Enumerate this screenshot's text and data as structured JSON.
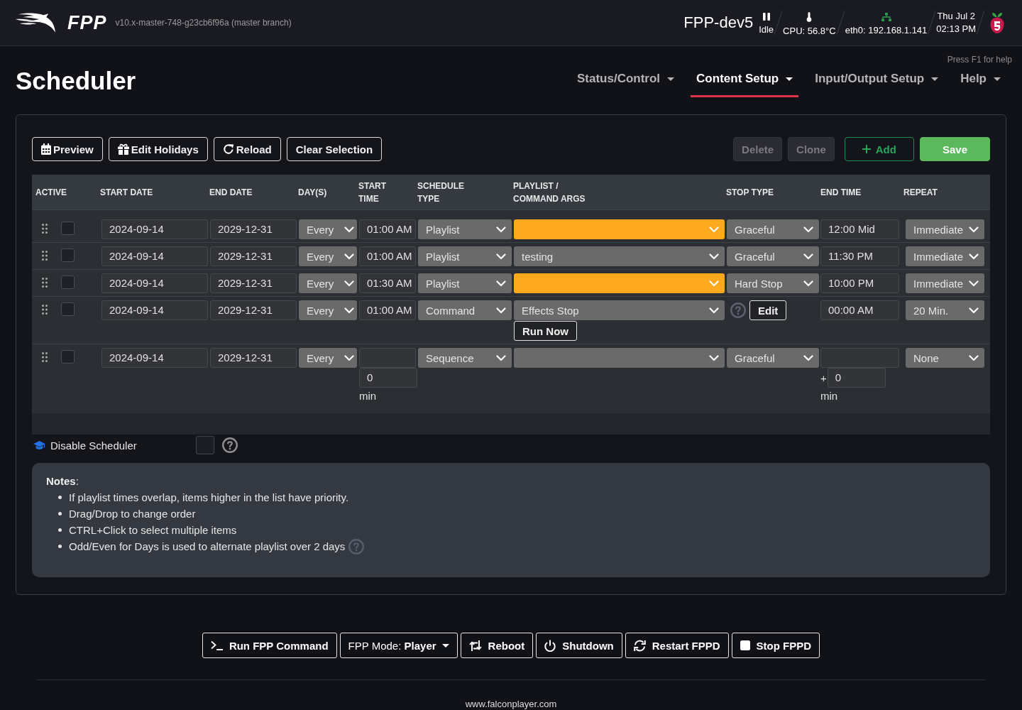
{
  "header": {
    "logo_text": "FPP",
    "version": "v10.x-master-748-g23cb6f96a (master branch)",
    "hostname": "FPP-dev5",
    "status": [
      {
        "kind": "player",
        "text": "Idle"
      },
      {
        "kind": "cpu",
        "text": "CPU: 56.8°C"
      },
      {
        "kind": "network",
        "text": "eth0: 192.168.1.141"
      },
      {
        "kind": "clock",
        "date": "Thu Jul 2",
        "time": "02:13 PM"
      }
    ]
  },
  "help_hint": "Press F1 for help",
  "title": "Scheduler",
  "nav": [
    {
      "label": "Status/Control",
      "selected": false
    },
    {
      "label": "Content Setup",
      "selected": true
    },
    {
      "label": "Input/Output Setup",
      "selected": false
    },
    {
      "label": "Help",
      "selected": false
    }
  ],
  "toolbar": {
    "left": [
      {
        "kind": "preview",
        "label": "Preview"
      },
      {
        "kind": "edit-holidays",
        "label": "Edit Holidays"
      },
      {
        "kind": "reload",
        "label": "Reload"
      },
      {
        "kind": "clear-selection",
        "label": "Clear Selection"
      }
    ],
    "right": [
      {
        "kind": "delete",
        "label": "Delete",
        "disabled": true
      },
      {
        "kind": "clone",
        "label": "Clone",
        "disabled": true
      },
      {
        "kind": "add",
        "label": "Add",
        "disabled": false
      },
      {
        "kind": "save",
        "label": "Save",
        "disabled": false
      }
    ]
  },
  "table": {
    "columns": [
      "ACTIVE",
      "START DATE",
      "END DATE",
      "DAY(S)",
      "START TIME",
      "SCHEDULE TYPE",
      "PLAYLIST / COMMAND ARGS",
      "STOP TYPE",
      "END TIME",
      "REPEAT"
    ],
    "rows": [
      {
        "kind": "playlist",
        "active": false,
        "start_date": "2024-09-14",
        "end_date": "2029-12-31",
        "days": "Every",
        "start_time": "01:00 AM",
        "schedule_type": "Playlist",
        "playlist": {
          "invalid": true
        },
        "stop_type": "Graceful",
        "end_time": "12:00 Mid",
        "repeat": "Immediate"
      },
      {
        "kind": "playlist",
        "active": false,
        "start_date": "2024-09-14",
        "end_date": "2029-12-31",
        "days": "Every",
        "start_time": "01:00 AM",
        "schedule_type": "Playlist",
        "playlist": {
          "value": "testing",
          "invalid": false
        },
        "stop_type": "Graceful",
        "end_time": "11:30 PM",
        "repeat": "Immediate"
      },
      {
        "kind": "playlist",
        "active": false,
        "start_date": "2024-09-14",
        "end_date": "2029-12-31",
        "days": "Every",
        "start_time": "01:30 AM",
        "schedule_type": "Playlist",
        "playlist": {
          "invalid": true
        },
        "stop_type": "Hard Stop",
        "end_time": "10:00 PM",
        "repeat": "Immediate"
      },
      {
        "kind": "command",
        "active": false,
        "start_date": "2024-09-14",
        "end_date": "2029-12-31",
        "days": "Every",
        "start_time": "01:00 AM",
        "schedule_type": "Command",
        "command": "Effects Stop",
        "edit_label": "Edit",
        "run_label": "Run Now",
        "end_time": "00:00 AM",
        "repeat": "20 Min."
      },
      {
        "kind": "sequence",
        "active": false,
        "start_date": "2024-09-14",
        "end_date": "2029-12-31",
        "days": "Every",
        "start_offset": {
          "value": "0",
          "unit": "min"
        },
        "schedule_type": "Sequence",
        "playlist": {
          "invalid": false
        },
        "stop_type": "Graceful",
        "end_offset": {
          "sign": "+",
          "value": "0",
          "unit": "min"
        },
        "repeat": "None"
      }
    ]
  },
  "disable_scheduler": {
    "label": "Disable Scheduler",
    "checked": false
  },
  "notes": {
    "title": "**Notes**:",
    "items": [
      {
        "text": "If playlist times overlap, items higher in the list have priority.",
        "help": false
      },
      {
        "text": "Drag/Drop to change order",
        "help": false
      },
      {
        "text": "CTRL+Click to select multiple items",
        "help": false
      },
      {
        "text": "Odd/Even for Days is used to alternate playlist over 2 days",
        "help": true
      }
    ]
  },
  "footer": {
    "buttons": [
      {
        "kind": "run-command",
        "label": "Run FPP Command"
      },
      {
        "kind": "mode",
        "label": "FPP Mode: **Player**"
      },
      {
        "kind": "reboot",
        "label": "Reboot"
      },
      {
        "kind": "shutdown",
        "label": "Shutdown"
      },
      {
        "kind": "restart",
        "label": "Restart FPPD"
      },
      {
        "kind": "stop",
        "label": "Stop FPPD"
      }
    ],
    "site": "www.falconplayer.com"
  }
}
